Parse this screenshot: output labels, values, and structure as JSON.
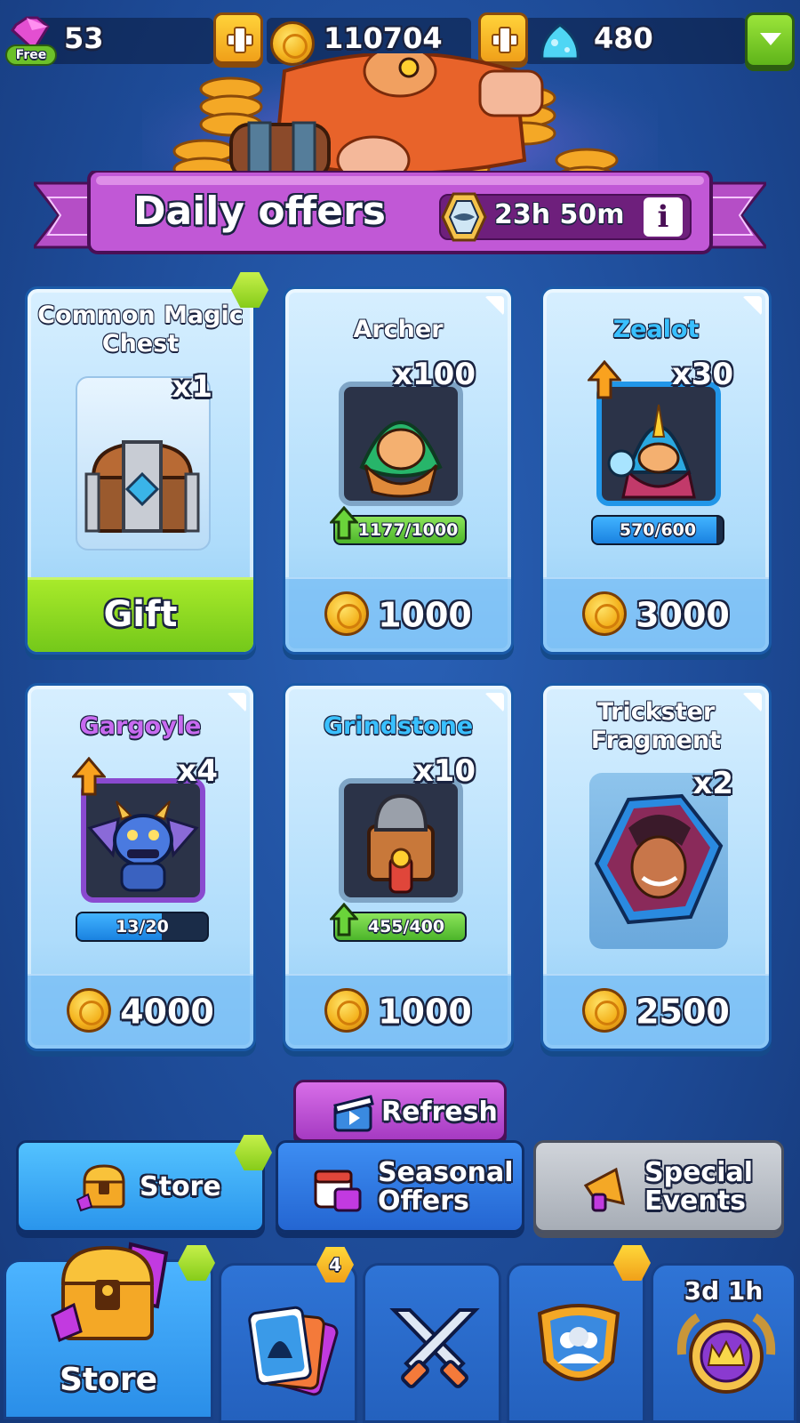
{
  "resources": {
    "gems": "53",
    "free_label": "Free",
    "coins": "110704",
    "crystals": "480"
  },
  "banner": {
    "title": "Daily offers",
    "timer": "23h 50m",
    "info_glyph": "i"
  },
  "offers": [
    {
      "title": "Common Magic Chest",
      "title_color": "#ffffff",
      "quantity": "x1",
      "action": "Gift",
      "icon": "chest-icon"
    },
    {
      "title": "Archer",
      "title_color": "#ffffff",
      "quantity": "x100",
      "progress": "1177/1000",
      "progress_ratio": 1.0,
      "price": "1000",
      "icon": "archer-portrait"
    },
    {
      "title": "Zealot",
      "title_color": "#39c0ff",
      "quantity": "x30",
      "progress": "570/600",
      "progress_ratio": 0.95,
      "price": "3000",
      "icon": "zealot-portrait"
    },
    {
      "title": "Gargoyle",
      "title_color": "#c86af0",
      "quantity": "x4",
      "progress": "13/20",
      "progress_ratio": 0.65,
      "price": "4000",
      "icon": "gargoyle-portrait"
    },
    {
      "title": "Grindstone",
      "title_color": "#39c0ff",
      "quantity": "x10",
      "progress": "455/400",
      "progress_ratio": 1.0,
      "price": "1000",
      "icon": "grindstone-portrait"
    },
    {
      "title": "Trickster Fragment",
      "title_color": "#ffffff",
      "quantity": "x2",
      "price": "2500",
      "icon": "trickster-fragment-portrait"
    }
  ],
  "refresh": {
    "label": "Refresh"
  },
  "categories": {
    "store": "Store",
    "seasonal_line1": "Seasonal",
    "seasonal_line2": "Offers",
    "special_line1": "Special",
    "special_line2": "Events"
  },
  "bottom_nav": {
    "store_label": "Store",
    "cards_badge": "4",
    "season_timer": "3d 1h"
  }
}
